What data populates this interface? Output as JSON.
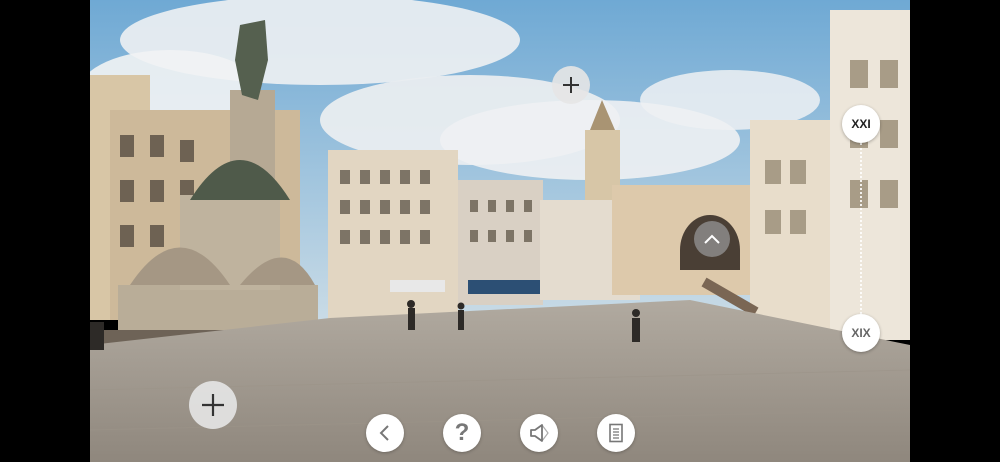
{
  "timeline": {
    "top_label": "XXI",
    "bottom_label": "XIX"
  },
  "colors": {
    "sky": "#7fb3d8",
    "cloud": "#e6ebee",
    "plaza": "#a49c92",
    "building": "#d8c9b0",
    "button_bg": "#ffffff",
    "icon": "#777777"
  },
  "icons": {
    "hotspot_top": "plus-icon",
    "hotspot_bottom": "plus-icon",
    "up": "chevron-up-icon",
    "back": "chevron-left-icon",
    "help": "question-mark-icon",
    "audio": "speaker-icon",
    "info": "document-icon"
  },
  "help_glyph": "?"
}
